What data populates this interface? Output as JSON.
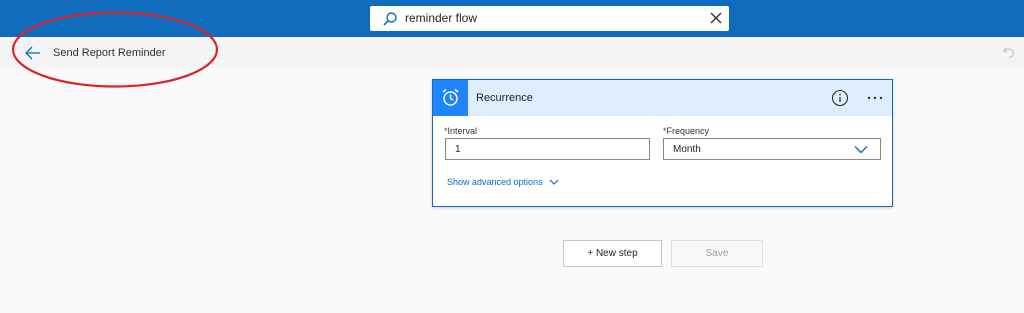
{
  "search": {
    "query": "reminder flow"
  },
  "header": {
    "flow_title": "Send Report Reminder"
  },
  "trigger": {
    "title": "Recurrence",
    "fields": {
      "interval": {
        "label": "Interval",
        "value": "1",
        "required_mark": "*"
      },
      "frequency": {
        "label": "Frequency",
        "value": "Month",
        "required_mark": "*"
      }
    },
    "advanced_link": "Show advanced options"
  },
  "actions": {
    "new_step": "+ New step",
    "save": "Save"
  },
  "colors": {
    "topbar": "#0f6cbd",
    "trigger_icon_bg": "#1f85ff",
    "card_header_bg": "#dfecfc",
    "annotation_red": "#d9232c"
  }
}
